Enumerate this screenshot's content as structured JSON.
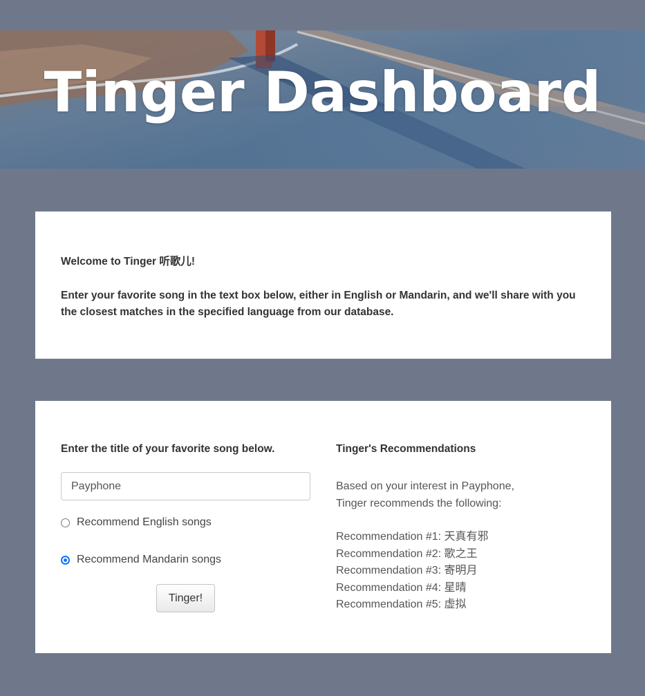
{
  "header": {
    "title": "Tinger Dashboard"
  },
  "intro": {
    "welcome": "Welcome to Tinger 听歌儿!",
    "description": "Enter your favorite song in the text box below, either in English or Mandarin, and we'll share with you the closest matches in the specified language from our database."
  },
  "search": {
    "heading": "Enter the title of your favorite song below.",
    "input_value": "Payphone",
    "options": [
      {
        "label": "Recommend English songs",
        "checked": false
      },
      {
        "label": "Recommend Mandarin songs",
        "checked": true
      }
    ],
    "button_label": "Tinger!"
  },
  "recommendations": {
    "heading": "Tinger's Recommendations",
    "intro_line1": "Based on your interest in Payphone,",
    "intro_line2": "Tinger recommends the following:",
    "items": [
      "Recommendation #1: 天真有邪",
      "Recommendation #2: 歌之王",
      "Recommendation #3: 寄明月",
      "Recommendation #4: 星晴",
      "Recommendation #5: 虚拟"
    ]
  },
  "colors": {
    "page_background": "#6f788b",
    "card_background": "#ffffff",
    "radio_accent": "#0a74ff"
  }
}
